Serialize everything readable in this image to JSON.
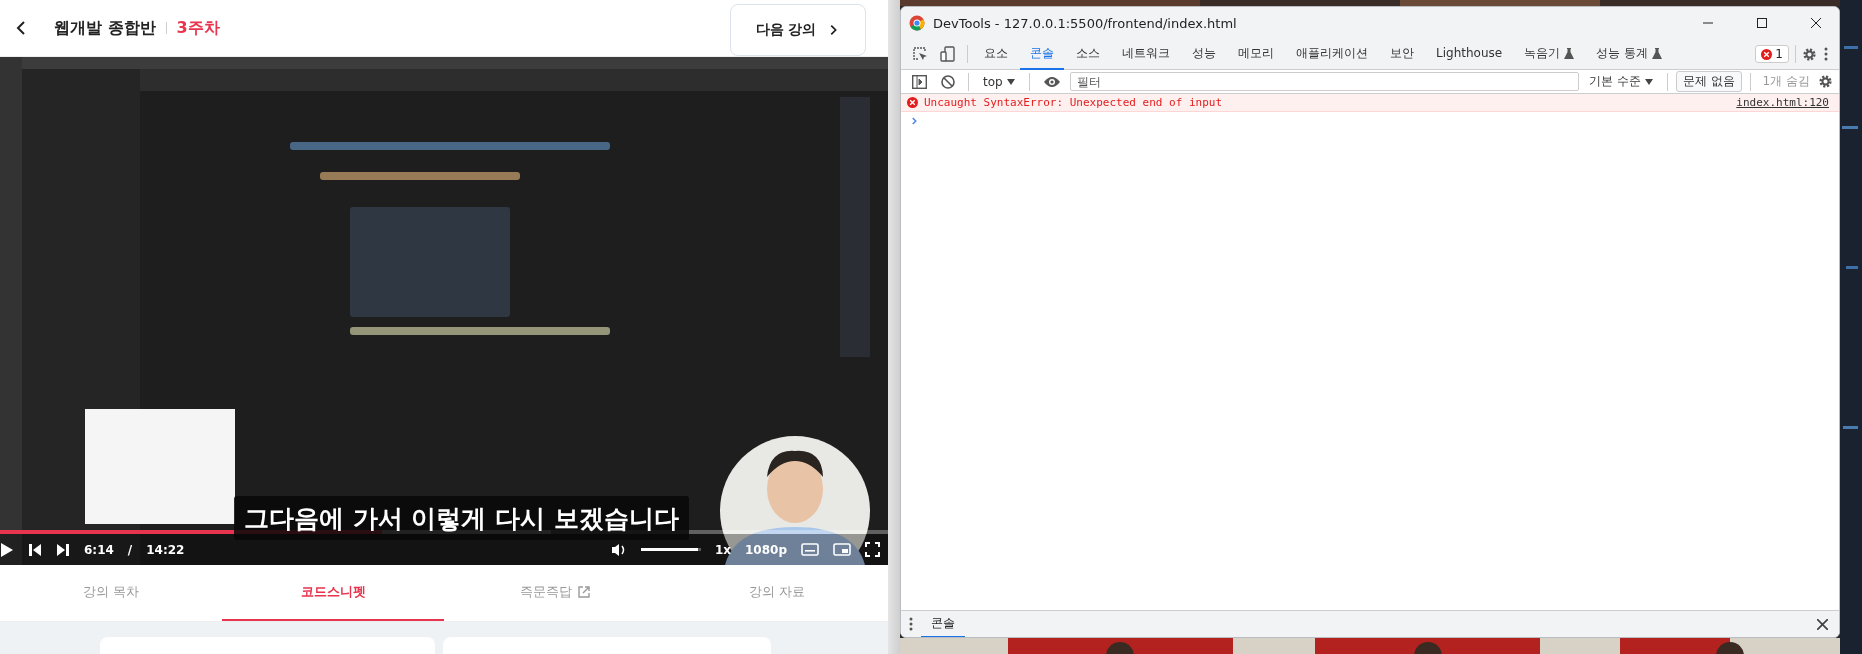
{
  "lecture_header": {
    "course": "웹개발 종합반",
    "week": "3주차",
    "next_button": "다음 강의"
  },
  "video_player": {
    "subtitle": "그다음에 가서 이렇게 다시 보겠습니다",
    "progress": {
      "level": 0.43
    },
    "current_time": "6:14",
    "separator": "/",
    "duration": "14:22",
    "volume": {
      "level": 0.95
    },
    "speed": "1x",
    "quality": "1080p"
  },
  "lecture_tabs": [
    {
      "label": "강의 목차",
      "selected": false,
      "external": false
    },
    {
      "label": "코드스니펫",
      "selected": true,
      "external": false
    },
    {
      "label": "즉문즉답",
      "selected": false,
      "external": true
    },
    {
      "label": "강의 자료",
      "selected": false,
      "external": false
    }
  ],
  "devtools": {
    "title": "DevTools - 127.0.0.1:5500/frontend/index.html",
    "tabs": [
      {
        "label": "요소",
        "selected": false,
        "experimental": false
      },
      {
        "label": "콘솔",
        "selected": true,
        "experimental": false
      },
      {
        "label": "소스",
        "selected": false,
        "experimental": false
      },
      {
        "label": "네트워크",
        "selected": false,
        "experimental": false
      },
      {
        "label": "성능",
        "selected": false,
        "experimental": false
      },
      {
        "label": "메모리",
        "selected": false,
        "experimental": false
      },
      {
        "label": "애플리케이션",
        "selected": false,
        "experimental": false
      },
      {
        "label": "보안",
        "selected": false,
        "experimental": false
      },
      {
        "label": "Lighthouse",
        "selected": false,
        "experimental": false
      },
      {
        "label": "녹음기",
        "selected": false,
        "experimental": true
      },
      {
        "label": "성능 통계",
        "selected": false,
        "experimental": true
      }
    ],
    "error_count": "1",
    "context": "top",
    "filter_placeholder": "필터",
    "log_level": "기본 수준",
    "issues": "문제 없음",
    "hidden_count": "1개 숨김",
    "console_messages": [
      {
        "kind": "error",
        "text": "Uncaught SyntaxError: Unexpected end of input",
        "source": "index.html:120"
      }
    ],
    "drawer_tabs": [
      {
        "label": "콘솔",
        "selected": true
      }
    ]
  }
}
